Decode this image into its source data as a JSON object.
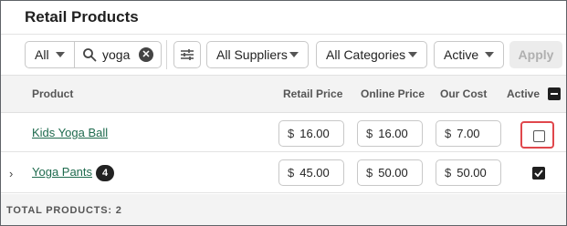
{
  "title": "Retail Products",
  "toolbar": {
    "scope_value": "All",
    "search_value": "yoga",
    "suppliers": "All Suppliers",
    "categories": "All Categories",
    "status": "Active",
    "apply_label": "Apply"
  },
  "table": {
    "columns": {
      "product": "Product",
      "retail_price": "Retail Price",
      "online_price": "Online Price",
      "our_cost": "Our Cost",
      "active": "Active"
    },
    "rows": [
      {
        "name": "Kids Yoga Ball",
        "retail": "16.00",
        "online": "16.00",
        "cost": "7.00",
        "active": false,
        "variants": ""
      },
      {
        "name": "Yoga Pants",
        "retail": "45.00",
        "online": "50.00",
        "cost": "50.00",
        "active": true,
        "variants": "4"
      }
    ],
    "currency": "$"
  },
  "footer": {
    "total": "TOTAL PRODUCTS: 2"
  },
  "colors": {
    "link": "#1f6b4e",
    "highlight": "#e0474c",
    "header_bg": "#f3f3f3"
  },
  "icons": [
    "search-icon",
    "clear-icon",
    "filter-sliders-icon",
    "chevron-down-icon",
    "chevron-right-icon",
    "checkbox-icon"
  ]
}
